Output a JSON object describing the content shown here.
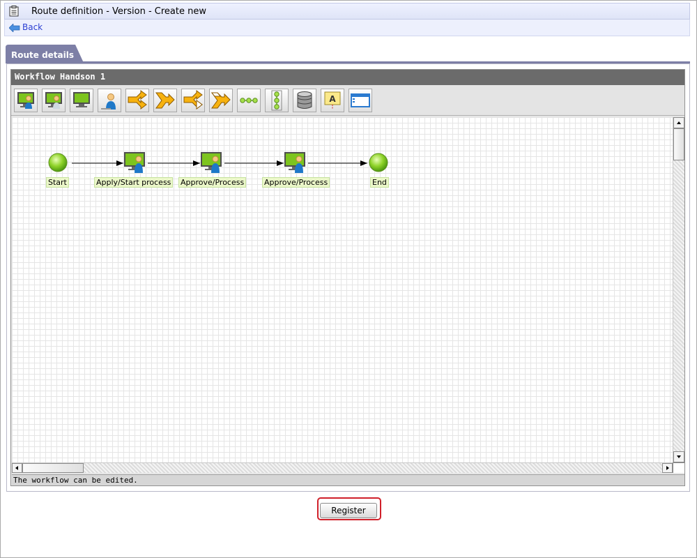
{
  "header": {
    "title": "Route definition - Version - Create new",
    "back_label": "Back"
  },
  "tab": {
    "label": "Route details"
  },
  "applet": {
    "title": "Workflow Handson 1",
    "status": "The workflow can be edited.",
    "toolbar": [
      "process-node-icon",
      "approval-node-icon",
      "display-node-icon",
      "user-node-icon",
      "branch-start-icon",
      "branch-end-icon",
      "split-start-icon",
      "split-end-icon",
      "horizontal-chain-icon",
      "vertical-chain-icon",
      "database-icon",
      "label-icon",
      "comment-box-icon"
    ],
    "nodes": [
      {
        "kind": "start",
        "label": "Start"
      },
      {
        "kind": "task",
        "label": "Apply/Start process"
      },
      {
        "kind": "task",
        "label": "Approve/Process"
      },
      {
        "kind": "task",
        "label": "Approve/Process"
      },
      {
        "kind": "end",
        "label": "End"
      }
    ]
  },
  "footer": {
    "register_label": "Register"
  },
  "colors": {
    "accent": "#7d7fa6",
    "link": "#2b3fd3",
    "highlight": "#d0202a",
    "node_green": "#7dc41e"
  }
}
